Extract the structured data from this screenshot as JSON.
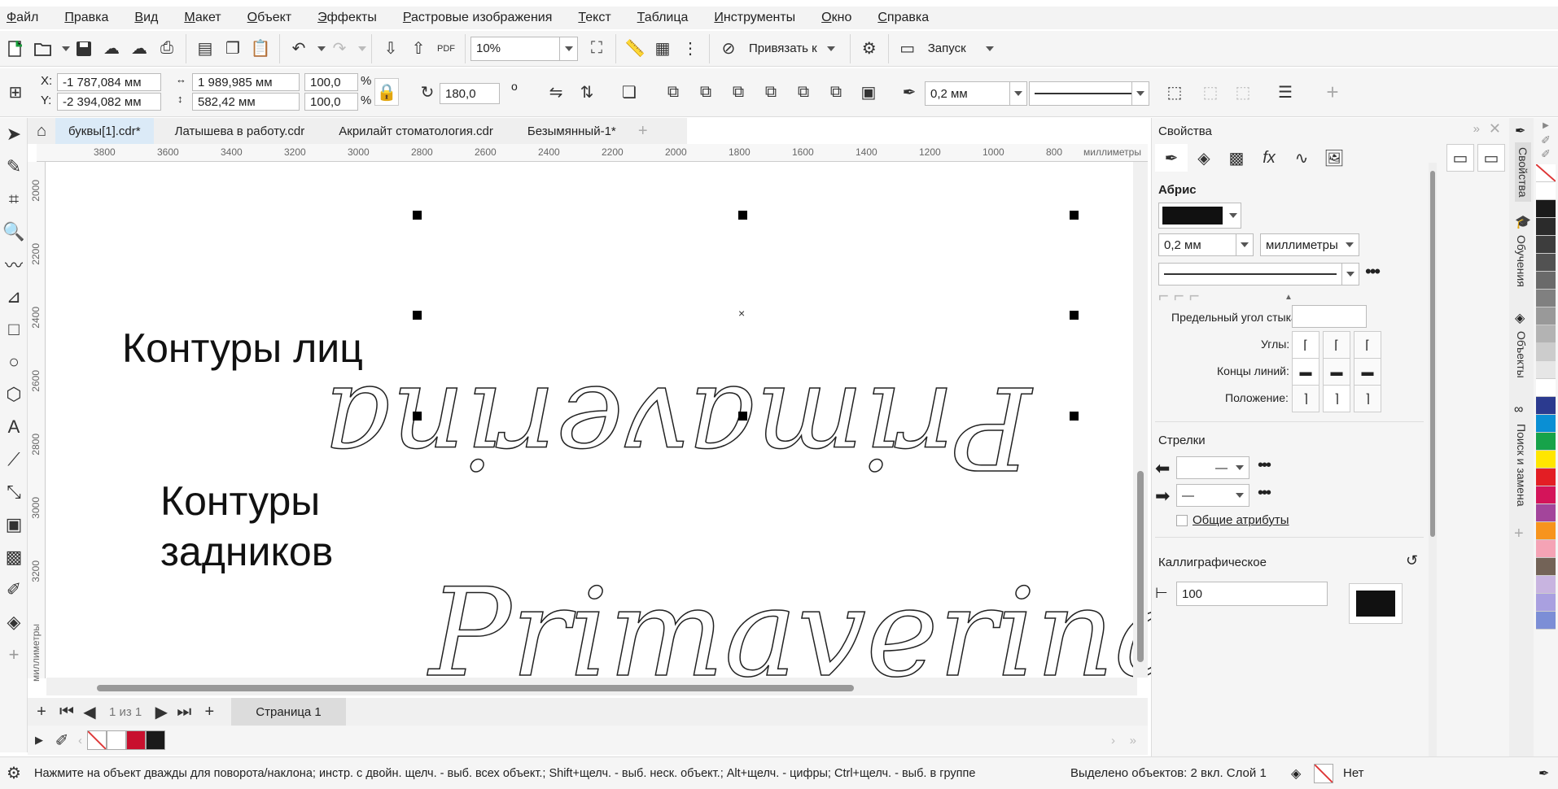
{
  "menu": [
    "Файл",
    "Правка",
    "Вид",
    "Макет",
    "Объект",
    "Эффекты",
    "Растровые изображения",
    "Текст",
    "Таблица",
    "Инструменты",
    "Окно",
    "Справка"
  ],
  "toolbar": {
    "zoom": "10%",
    "snap_label": "Привязать к",
    "launch_label": "Запуск"
  },
  "propbar": {
    "x_label": "X:",
    "x_value": "-1 787,084 мм",
    "y_label": "Y:",
    "y_value": "-2 394,082 мм",
    "w_value": "1 989,985 мм",
    "h_value": "582,42 мм",
    "w_pct": "100,0",
    "h_pct": "100,0",
    "pct_sign": "%",
    "angle": "180,0",
    "degree_sign": "o",
    "outline_width": "0,2 мм"
  },
  "doctabs": [
    "буквы[1].cdr*",
    "Латышева в работу.cdr",
    "Акрилайт стоматология.cdr",
    "Безымянный-1*"
  ],
  "ruler": {
    "h_ticks": [
      "3800",
      "3600",
      "3400",
      "3200",
      "3000",
      "2800",
      "2600",
      "2400",
      "2200",
      "2000",
      "1800",
      "1600",
      "1400",
      "1200",
      "1000",
      "800"
    ],
    "h_unit": "миллиметры",
    "v_ticks": [
      "2000",
      "2200",
      "2400",
      "2600",
      "2800",
      "3000",
      "3200"
    ],
    "v_unit": "миллиметры"
  },
  "canvas": {
    "label_faces": "Контуры лиц",
    "label_backs_1": "Контуры",
    "label_backs_2": "задников",
    "script_text": "Primaverina"
  },
  "pagenav": {
    "page_of": "1 из 1",
    "page_tab": "Страница 1"
  },
  "status": {
    "hint": "Нажмите на объект дважды для поворота/наклона; инстр. с двойн. щелч. - выб. всех объект.; Shift+щелч. - выб. неск. объект.; Alt+щелч. - цифры; Ctrl+щелч. - выб. в группе",
    "selection": "Выделено объектов: 2 вкл. Слой 1",
    "fill": "Нет"
  },
  "panel": {
    "title": "Свойства",
    "outline_heading": "Абрис",
    "width_value": "0,2 мм",
    "units": "миллиметры",
    "miter_label": "Предельный угол стыка:",
    "corners_label": "Углы:",
    "caps_label": "Концы линий:",
    "position_label": "Положение:",
    "arrows_heading": "Стрелки",
    "shared_attrs": "Общие атрибуты",
    "calligraphic_heading": "Каллиграфическое",
    "stretch_value": "100"
  },
  "side_tabs": [
    "Свойства",
    "Обучения",
    "Объекты",
    "Поиск и замена"
  ],
  "palette_colors": [
    "#ffffff",
    "#1a1a1a",
    "#2b2b2b",
    "#3d3d3d",
    "#525252",
    "#6a6a6a",
    "#808080",
    "#999999",
    "#b3b3b3",
    "#cccccc",
    "#e6e6e6",
    "#ffffff",
    "#2b3a8f",
    "#0a8fd4",
    "#17a34a",
    "#ffe600",
    "#e31e24",
    "#d4145a",
    "#a3459b",
    "#f7941d",
    "#f5a3b5",
    "#736357",
    "#c8b4e0",
    "#a9a0e0",
    "#7c8ed6"
  ],
  "colors": {
    "accent": "#dbeaf7",
    "doc_swatch_red": "#c8102e"
  }
}
